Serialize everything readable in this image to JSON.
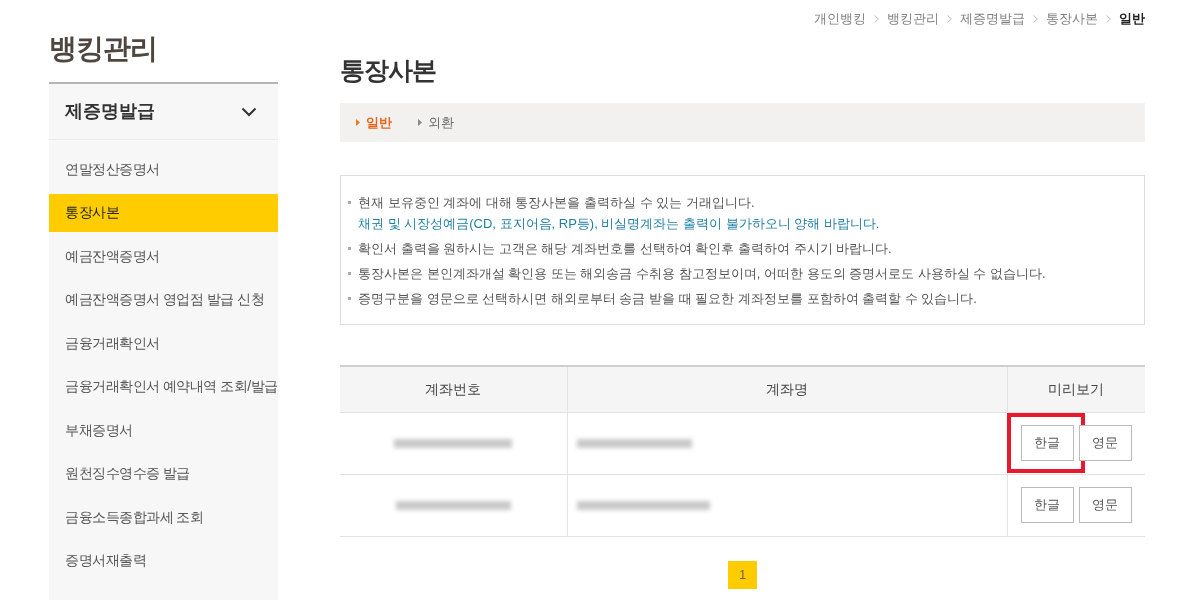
{
  "breadcrumb": [
    {
      "label": "개인뱅킹",
      "current": false
    },
    {
      "label": "뱅킹관리",
      "current": false
    },
    {
      "label": "제증명발급",
      "current": false
    },
    {
      "label": "통장사본",
      "current": false
    },
    {
      "label": "일반",
      "current": true
    }
  ],
  "sidebar": {
    "title": "뱅킹관리",
    "section": {
      "label": "제증명발급",
      "expanded": true
    },
    "items": [
      {
        "label": "연말정산증명서",
        "selected": false
      },
      {
        "label": "통장사본",
        "selected": true
      },
      {
        "label": "예금잔액증명서",
        "selected": false
      },
      {
        "label": "예금잔액증명서 영업점 발급 신청",
        "selected": false
      },
      {
        "label": "금융거래확인서",
        "selected": false
      },
      {
        "label": "금융거래확인서 예약내역 조회/발급",
        "selected": false
      },
      {
        "label": "부채증명서",
        "selected": false
      },
      {
        "label": "원천징수영수증 발급",
        "selected": false
      },
      {
        "label": "금융소득종합과세 조회",
        "selected": false
      },
      {
        "label": "증명서재출력",
        "selected": false
      }
    ]
  },
  "page_title": "통장사본",
  "tabs": [
    {
      "label": "일반",
      "selected": true
    },
    {
      "label": "외환",
      "selected": false
    }
  ],
  "notice": [
    {
      "text": "현재 보유중인 계좌에 대해 통장사본을 출력하실 수 있는 거래입니다.",
      "note": "채권 및 시장성예금(CD, 표지어음, RP등), 비실명계좌는 출력이 불가하오니 양해 바랍니다."
    },
    {
      "text": "확인서 출력을 원하시는 고객은 해당 계좌번호를 선택하여 확인후 출력하여 주시기 바랍니다."
    },
    {
      "text": "통장사본은 본인계좌개설 확인용 또는 해외송금 수취용 참고정보이며, 어떠한 용도의 증명서로도 사용하실 수 없습니다."
    },
    {
      "text": "증명구분을 영문으로 선택하시면 해외로부터 송금 받을 때 필요한 계좌정보를 포함하여 출력할 수 있습니다."
    }
  ],
  "table": {
    "columns": [
      "계좌번호",
      "계좌명",
      "미리보기"
    ],
    "rows": [
      {
        "buttons": [
          {
            "label": "한글",
            "highlighted": true
          },
          {
            "label": "영문",
            "highlighted": false
          }
        ]
      },
      {
        "buttons": [
          {
            "label": "한글",
            "highlighted": false
          },
          {
            "label": "영문",
            "highlighted": false
          }
        ]
      }
    ]
  },
  "pagination": [
    {
      "label": "1",
      "selected": true
    }
  ]
}
